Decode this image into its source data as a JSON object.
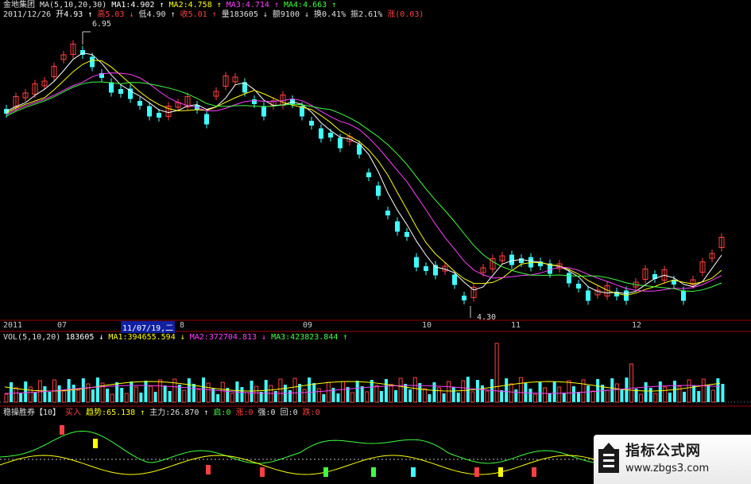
{
  "main": {
    "row1": [
      {
        "t": "金地集团",
        "c": "#e0e0e0"
      },
      {
        "t": "MA(5,10,20,30)",
        "c": "#e0e0e0"
      },
      {
        "t": "MA1:4.902 ↑",
        "c": "#ffffff"
      },
      {
        "t": "MA2:4.758 ↑",
        "c": "#ffff00"
      },
      {
        "t": "MA3:4.714 ↑",
        "c": "#ff40ff"
      },
      {
        "t": "MA4:4.663 ↑",
        "c": "#40ff40"
      }
    ],
    "row2": [
      {
        "t": "2011/12/26",
        "c": "#e0e0e0"
      },
      {
        "t": "开4.93 ↑",
        "c": "#ffffff"
      },
      {
        "t": "高5.03 ↓",
        "c": "#ff4040"
      },
      {
        "t": "低4.90 ↑",
        "c": "#e0e0e0"
      },
      {
        "t": "收5.01 ↑",
        "c": "#ff4040"
      },
      {
        "t": "量183605 ↓",
        "c": "#e0e0e0"
      },
      {
        "t": "额9100 ↓",
        "c": "#e0e0e0"
      },
      {
        "t": "换0.41%",
        "c": "#e0e0e0"
      },
      {
        "t": "振2.61%",
        "c": "#e0e0e0"
      },
      {
        "t": "涨(0.03)",
        "c": "#ff4040"
      }
    ],
    "high_label": "6.95",
    "low_label": "4.30"
  },
  "axis": {
    "labels": [
      "2011",
      "07",
      "11/07/19,二",
      "8",
      "09",
      "10",
      "11",
      "12"
    ]
  },
  "vol": {
    "row": [
      {
        "t": "VOL(5,10,20)",
        "c": "#e0e0e0"
      },
      {
        "t": "183605 ↓",
        "c": "#ffffff"
      },
      {
        "t": "MA1:394655.594 ↓",
        "c": "#ffff00"
      },
      {
        "t": "MA2:372704.813 ↓",
        "c": "#ff40ff"
      },
      {
        "t": "MA3:423823.844 ↑",
        "c": "#40ff40"
      }
    ]
  },
  "ind": {
    "row": [
      {
        "t": "稳操胜券【10】",
        "c": "#e0e0e0"
      },
      {
        "t": "买入",
        "c": "#ff4040"
      },
      {
        "t": "趋势:65.138 ↑",
        "c": "#ffff00"
      },
      {
        "t": "主力:26.870 ↑",
        "c": "#e0e0e0"
      },
      {
        "t": "启:0",
        "c": "#40ff40"
      },
      {
        "t": "涨:0",
        "c": "#ff4040"
      },
      {
        "t": "强:0",
        "c": "#e0e0e0"
      },
      {
        "t": "回:0",
        "c": "#e0e0e0"
      },
      {
        "t": "跌:0",
        "c": "#ff4040"
      }
    ]
  },
  "watermark": {
    "title": "指标公式网",
    "url": "www.zbgs3.com"
  },
  "colors": {
    "up": "#ff4040",
    "down": "#40ffff",
    "ma1": "#ffffff",
    "ma2": "#ffff00",
    "ma3": "#ff40ff",
    "ma4": "#40ff40",
    "grid": "#a00000"
  }
}
